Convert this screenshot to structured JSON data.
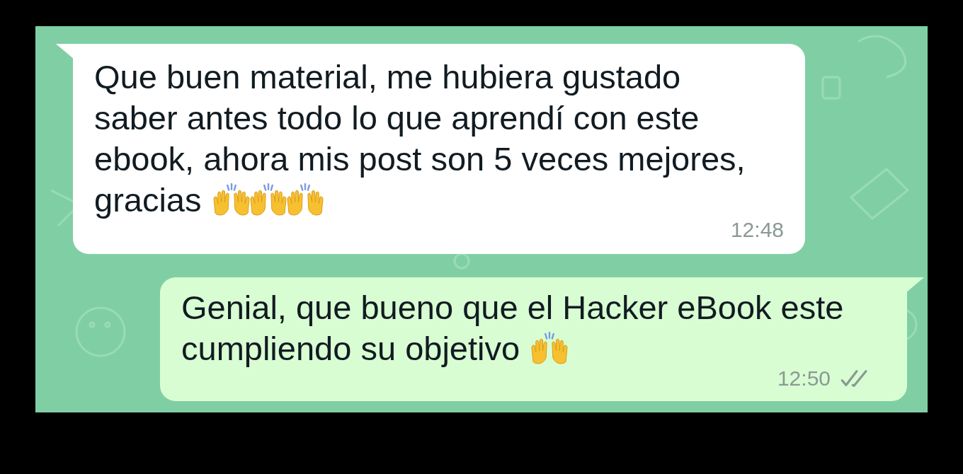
{
  "messages": [
    {
      "kind": "incoming",
      "text": "Que buen material, me hubiera gustado saber antes todo lo que aprendí con este ebook, ahora mis post son 5 veces mejores, gracias",
      "emojis": [
        {
          "kind": "raised-hands"
        },
        {
          "kind": "raised-hands"
        },
        {
          "kind": "raised-hands"
        }
      ],
      "time": "12:48"
    },
    {
      "kind": "outgoing",
      "text": "Genial, que bueno que el Hacker eBook este cumpliendo su objetivo",
      "emojis": [
        {
          "kind": "raised-hands"
        }
      ],
      "time": "12:50",
      "read": false
    }
  ]
}
